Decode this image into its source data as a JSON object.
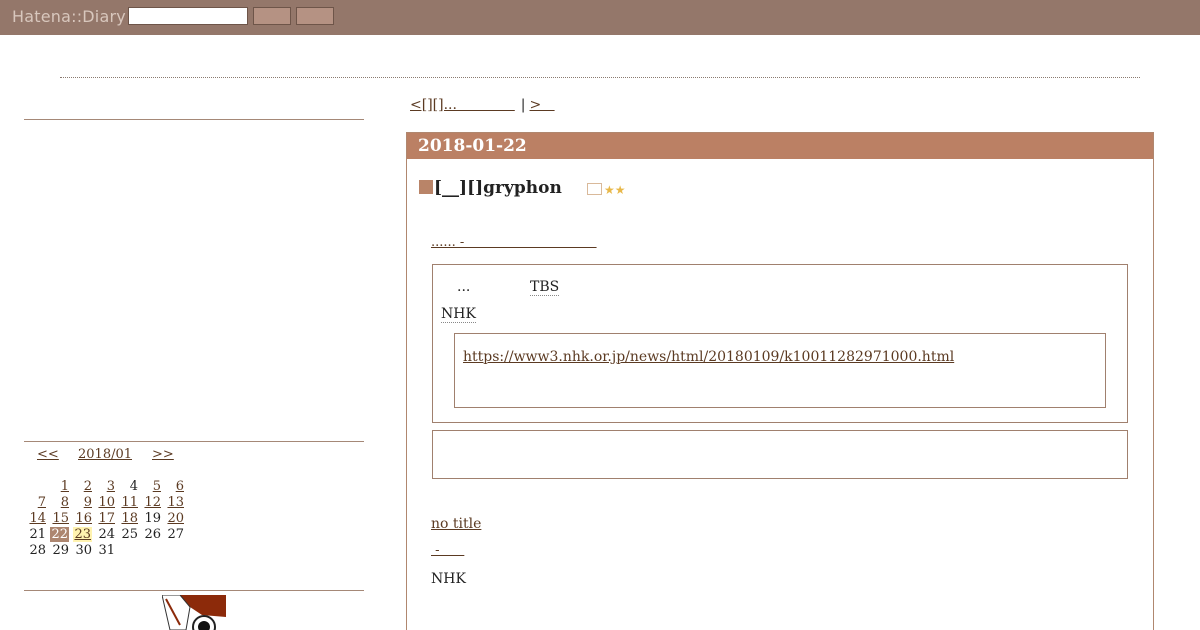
{
  "header": {
    "logo": "Hatena::Diary",
    "search_value": "",
    "button1_label": "",
    "button2_label": ""
  },
  "pager": {
    "prev_label": "<[][]...             ",
    "separator": "|",
    "next_label": ">   "
  },
  "calendar": {
    "prev_label": "<<",
    "month_label": "2018/01",
    "next_label": ">>",
    "weeks": [
      [
        "",
        "1",
        "2",
        "3",
        "4",
        "5",
        "6"
      ],
      [
        "7",
        "8",
        "9",
        "10",
        "11",
        "12",
        "13"
      ],
      [
        "14",
        "15",
        "16",
        "17",
        "18",
        "19",
        "20"
      ],
      [
        "21",
        "22",
        "23",
        "24",
        "25",
        "26",
        "27"
      ],
      [
        "28",
        "29",
        "30",
        "31",
        "",
        "",
        ""
      ]
    ],
    "linked_days": [
      "1",
      "2",
      "3",
      "5",
      "6",
      "7",
      "8",
      "9",
      "10",
      "11",
      "12",
      "13",
      "14",
      "15",
      "16",
      "17",
      "18",
      "20",
      "22",
      "23"
    ],
    "today": "22",
    "highlight": "23"
  },
  "day": {
    "date": "2018-01-22",
    "entry_title": "[__][]gryphon",
    "stars": "★★",
    "ref_link": "...... -                                ",
    "quote": {
      "ellipsis": "...",
      "tbs": "TBS",
      "nhk": "NHK",
      "url": "https://www3.nhk.or.jp/news/html/20180109/k10011282971000.html"
    },
    "second_title": "no title",
    "dash_link": " -      ",
    "nhk2": "NHK"
  },
  "colors": {
    "header_bg": "#94776a",
    "date_bar": "#bb8064",
    "link": "#5b3a22"
  }
}
